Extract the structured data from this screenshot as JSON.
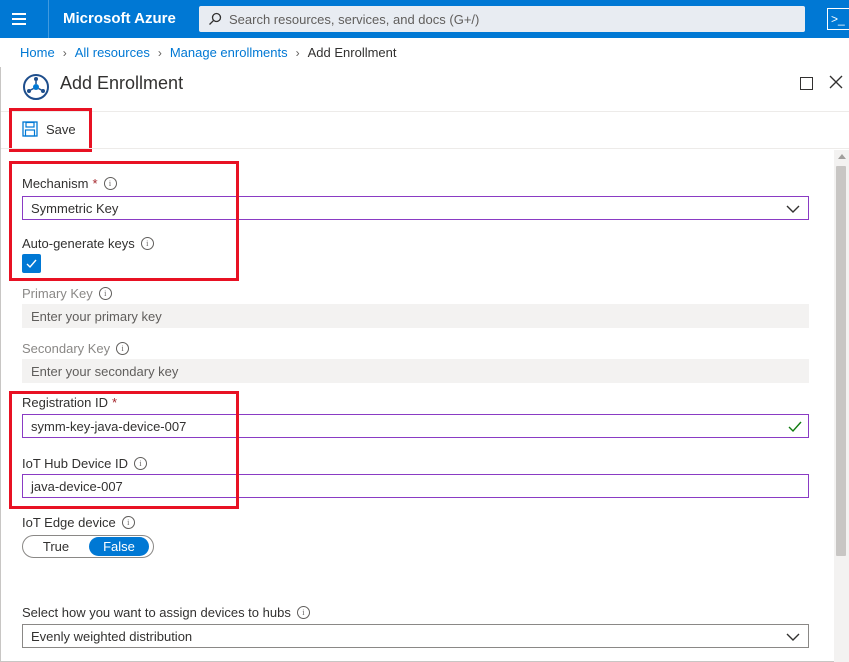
{
  "topbar": {
    "brand": "Microsoft Azure",
    "search_placeholder": "Search resources, services, and docs (G+/)",
    "cloud_shell_glyph": ">_"
  },
  "breadcrumb": {
    "items": [
      "Home",
      "All resources",
      "Manage enrollments"
    ],
    "current": "Add Enrollment"
  },
  "blade": {
    "title": "Add Enrollment"
  },
  "toolbar": {
    "save_label": "Save"
  },
  "form": {
    "mechanism": {
      "label": "Mechanism",
      "required": "*",
      "value": "Symmetric Key"
    },
    "auto_generate": {
      "label": "Auto-generate keys",
      "checked": true
    },
    "primary_key": {
      "label": "Primary Key",
      "placeholder": "Enter your primary key"
    },
    "secondary_key": {
      "label": "Secondary Key",
      "placeholder": "Enter your secondary key"
    },
    "registration_id": {
      "label": "Registration ID",
      "required": "*",
      "value": "symm-key-java-device-007"
    },
    "iot_hub_device_id": {
      "label": "IoT Hub Device ID",
      "value": "java-device-007"
    },
    "iot_edge": {
      "label": "IoT Edge device",
      "true_label": "True",
      "false_label": "False",
      "selected": "False"
    },
    "assign_hubs": {
      "label": "Select how you want to assign devices to hubs",
      "value": "Evenly weighted distribution"
    }
  },
  "colors": {
    "azure_blue": "#0078d4",
    "highlight_red": "#e81123",
    "focus_purple": "#8a3bc4",
    "valid_green": "#107c10"
  }
}
